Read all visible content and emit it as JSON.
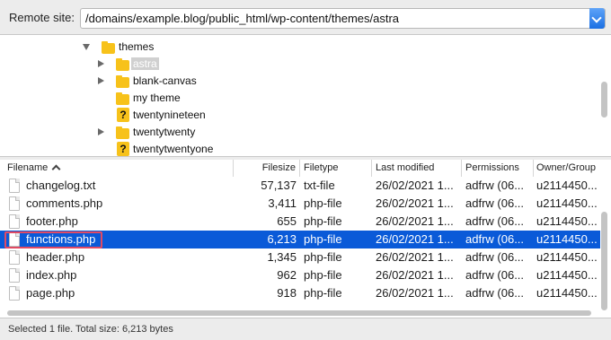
{
  "remote_site": {
    "label": "Remote site:",
    "path": "/domains/example.blog/public_html/wp-content/themes/astra"
  },
  "tree": {
    "items": [
      {
        "label": "themes",
        "expander": "expanded",
        "icon": "folder-icon",
        "selected": false
      },
      {
        "label": "astra",
        "expander": "collapsed",
        "icon": "folder-icon",
        "selected": true
      },
      {
        "label": "blank-canvas",
        "expander": "collapsed",
        "icon": "folder-icon",
        "selected": false
      },
      {
        "label": "my theme",
        "expander": "none",
        "icon": "folder-icon",
        "selected": false
      },
      {
        "label": "twentynineteen",
        "expander": "none",
        "icon": "unknown-folder-icon",
        "selected": false
      },
      {
        "label": "twentytwenty",
        "expander": "collapsed",
        "icon": "folder-icon",
        "selected": false
      },
      {
        "label": "twentytwentyone",
        "expander": "none",
        "icon": "unknown-folder-icon",
        "selected": false
      }
    ]
  },
  "file_list": {
    "columns": [
      "Filename",
      "Filesize",
      "Filetype",
      "Last modified",
      "Permissions",
      "Owner/Group"
    ],
    "rows": [
      {
        "name": "changelog.txt",
        "size": "57,137",
        "type": "txt-file",
        "modified": "26/02/2021 1...",
        "perms": "adfrw (06...",
        "owner": "u2114450..."
      },
      {
        "name": "comments.php",
        "size": "3,411",
        "type": "php-file",
        "modified": "26/02/2021 1...",
        "perms": "adfrw (06...",
        "owner": "u2114450..."
      },
      {
        "name": "footer.php",
        "size": "655",
        "type": "php-file",
        "modified": "26/02/2021 1...",
        "perms": "adfrw (06...",
        "owner": "u2114450..."
      },
      {
        "name": "functions.php",
        "size": "6,213",
        "type": "php-file",
        "modified": "26/02/2021 1...",
        "perms": "adfrw (06...",
        "owner": "u2114450..."
      },
      {
        "name": "header.php",
        "size": "1,345",
        "type": "php-file",
        "modified": "26/02/2021 1...",
        "perms": "adfrw (06...",
        "owner": "u2114450..."
      },
      {
        "name": "index.php",
        "size": "962",
        "type": "php-file",
        "modified": "26/02/2021 1...",
        "perms": "adfrw (06...",
        "owner": "u2114450..."
      },
      {
        "name": "page.php",
        "size": "918",
        "type": "php-file",
        "modified": "26/02/2021 1...",
        "perms": "adfrw (06...",
        "owner": "u2114450..."
      }
    ],
    "selected_index": 3
  },
  "status_bar": {
    "text": "Selected 1 file. Total size: 6,213 bytes"
  },
  "colors": {
    "selection": "#0a5ad8",
    "folder": "#f7c21a",
    "highlight_border": "#e04a64"
  }
}
